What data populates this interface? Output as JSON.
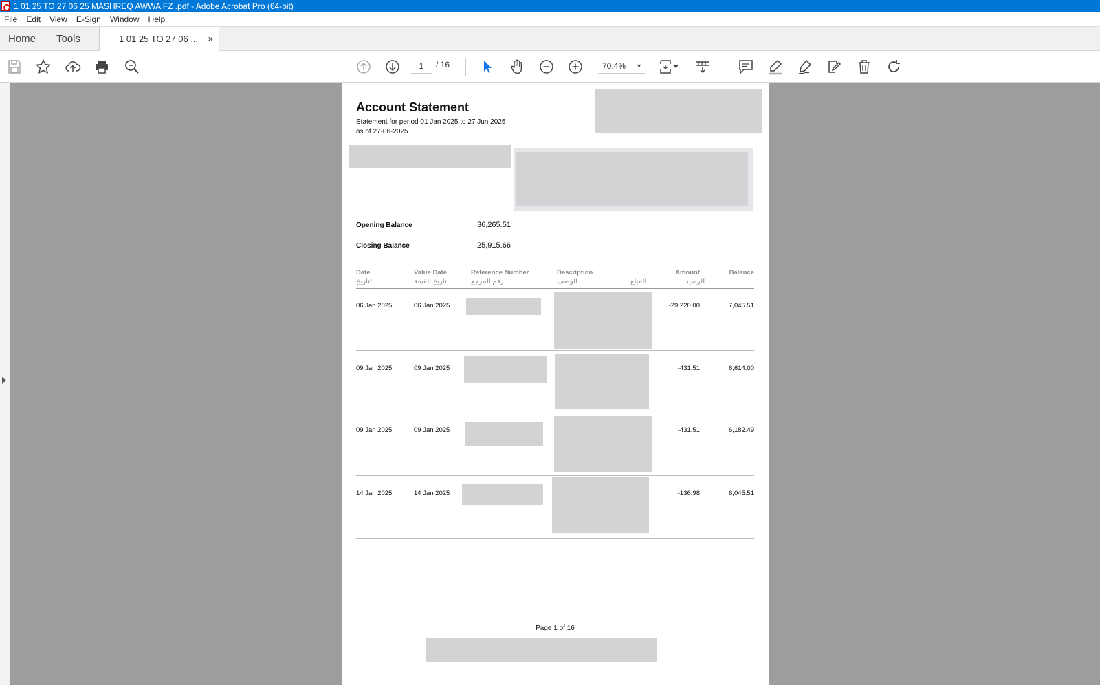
{
  "window": {
    "title": "1 01 25 TO 27 06 25 MASHREQ AWWA FZ .pdf - Adobe Acrobat Pro (64-bit)"
  },
  "menu": [
    "File",
    "Edit",
    "View",
    "E-Sign",
    "Window",
    "Help"
  ],
  "tabs": {
    "home": "Home",
    "tools": "Tools",
    "document": "1 01 25 TO 27 06 ...",
    "close": "×"
  },
  "toolbar": {
    "page_current": "1",
    "page_total": "/ 16",
    "zoom": "70.4%"
  },
  "document": {
    "title": "Account Statement",
    "period": "Statement for period 01 Jan 2025 to 27 Jun 2025",
    "as_of": "as of 27-06-2025",
    "opening_label": "Opening Balance",
    "opening_value": "36,265.51",
    "closing_label": "Closing Balance",
    "closing_value": "25,915.66",
    "headers": {
      "date": "Date",
      "date_ar": "التاريخ",
      "value_date": "Value Date",
      "value_date_ar": "تاريخ القيمة",
      "reference": "Reference Number",
      "reference_ar": "رقم المرجع",
      "description": "Description",
      "description_ar": "الوصف",
      "amount": "Amount",
      "amount_ar": "المبلغ",
      "balance": "Balance",
      "balance_ar": "الرصيد"
    },
    "rows": [
      {
        "date": "06 Jan 2025",
        "value_date": "06 Jan 2025",
        "amount": "-29,220.00",
        "balance": "7,045.51"
      },
      {
        "date": "09 Jan 2025",
        "value_date": "09 Jan 2025",
        "amount": "-431.51",
        "balance": "6,614.00"
      },
      {
        "date": "09 Jan 2025",
        "value_date": "09 Jan 2025",
        "amount": "-431.51",
        "balance": "6,182.49"
      },
      {
        "date": "14 Jan 2025",
        "value_date": "14 Jan 2025",
        "amount": "-136.98",
        "balance": "6,045.51"
      }
    ],
    "footer": "Page 1 of 16"
  }
}
